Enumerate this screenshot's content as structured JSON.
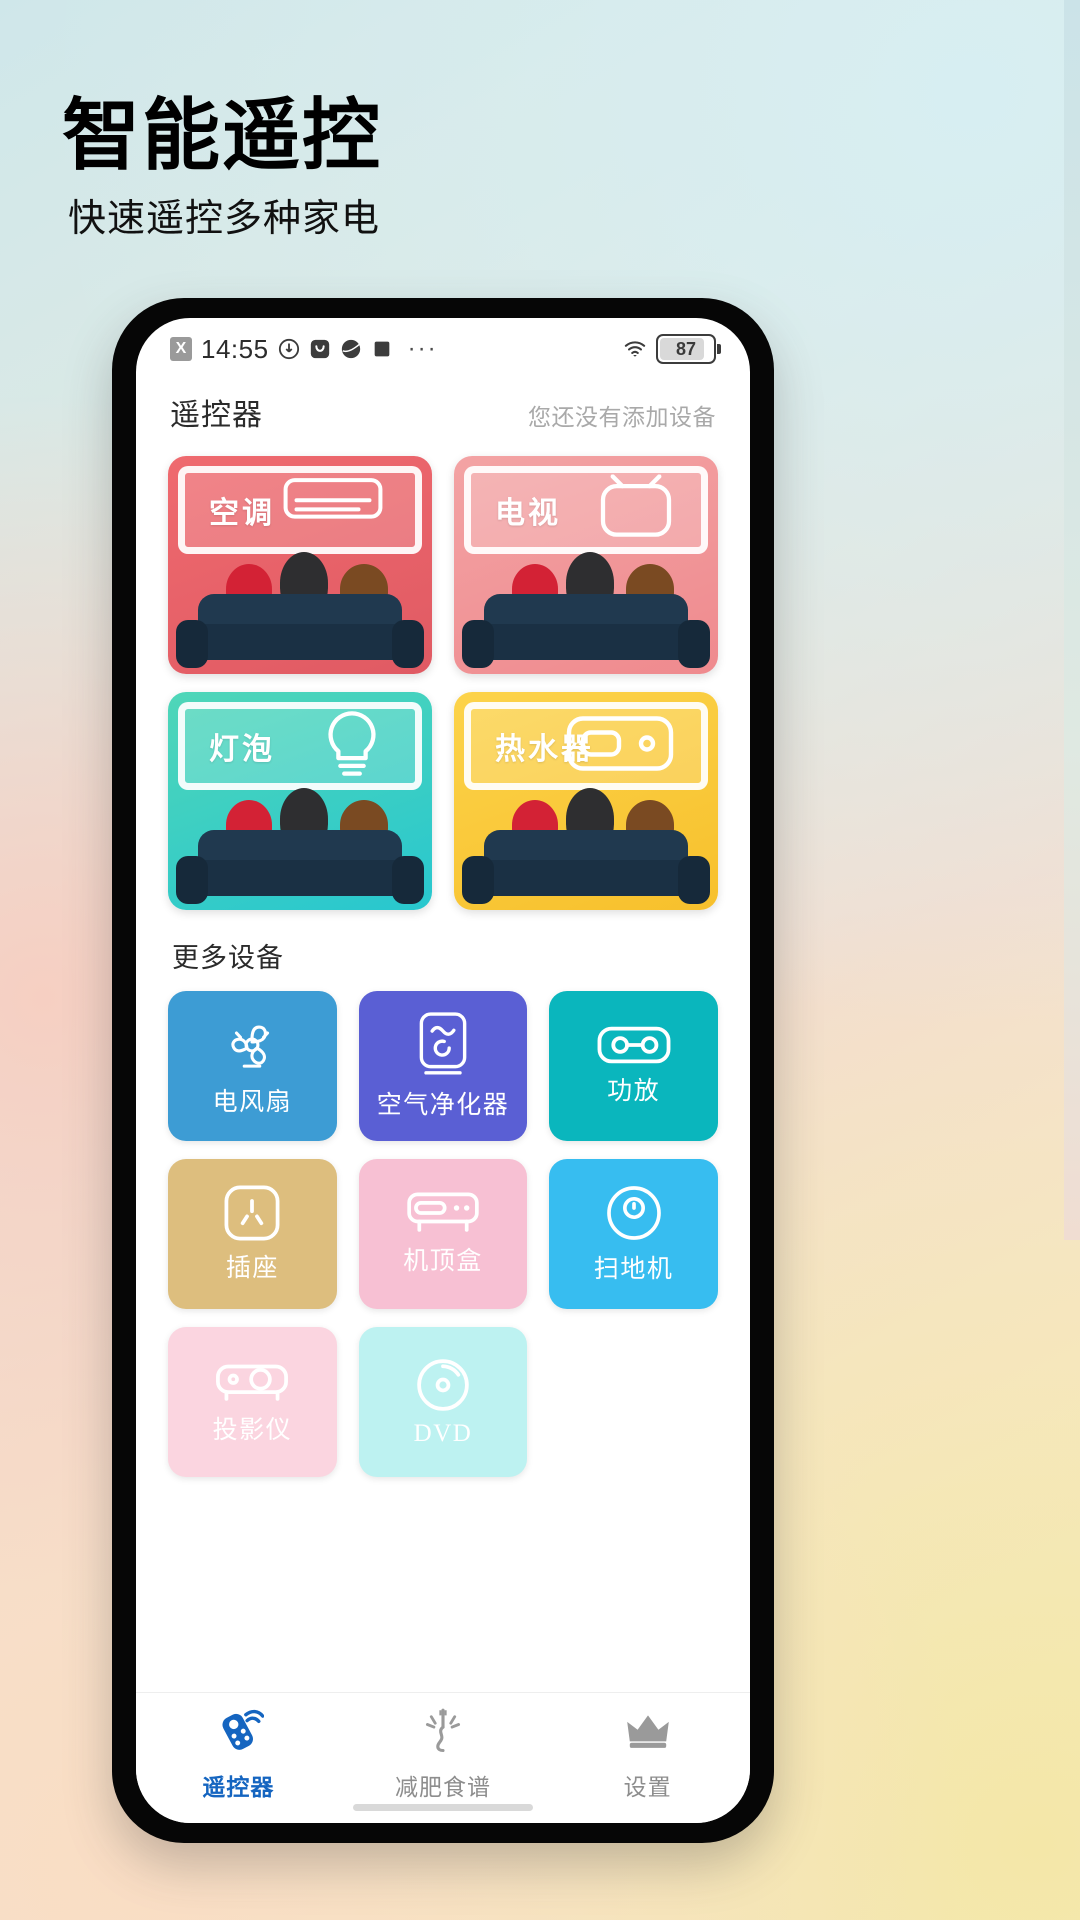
{
  "promo": {
    "title": "智能遥控",
    "subtitle": "快速遥控多种家电"
  },
  "statusbar": {
    "sim_badge": "X",
    "time": "14:55",
    "overflow_dots": "···",
    "battery_percent": "87",
    "icons": [
      "sim-x-icon",
      "clock-arrow-icon",
      "message-icon",
      "globe-icon",
      "square-icon",
      "more-dots-icon",
      "wifi-icon",
      "battery-icon"
    ]
  },
  "app_header": {
    "title": "遥控器",
    "hint": "您还没有添加设备"
  },
  "featured_devices": [
    {
      "label": "空调",
      "icon": "air-conditioner-icon",
      "color_top": "#ef6a6f",
      "color_bottom": "#e05a63",
      "screen_bg": "rgba(255,255,255,0.18)"
    },
    {
      "label": "电视",
      "icon": "television-icon",
      "color_top": "#f3a3a4",
      "color_bottom": "#ef8a8e",
      "screen_bg": "rgba(255,255,255,0.20)"
    },
    {
      "label": "灯泡",
      "icon": "light-bulb-icon",
      "color_top": "#4fd6b8",
      "color_bottom": "#28c7cf",
      "screen_bg": "rgba(255,255,255,0.18)"
    },
    {
      "label": "热水器",
      "icon": "water-heater-icon",
      "color_top": "#fcd34a",
      "color_bottom": "#f7c02c",
      "screen_bg": "rgba(255,255,255,0.18)"
    }
  ],
  "more_section": {
    "title": "更多设备",
    "devices": [
      {
        "label": "电风扇",
        "icon": "fan-icon",
        "color": "#3d9cd4"
      },
      {
        "label": "空气净化器",
        "icon": "air-purifier-icon",
        "color": "#5a5fd4"
      },
      {
        "label": "功放",
        "icon": "amplifier-icon",
        "color": "#0ab6bd"
      },
      {
        "label": "插座",
        "icon": "power-socket-icon",
        "color": "#ddbe7e"
      },
      {
        "label": "机顶盒",
        "icon": "set-top-box-icon",
        "color": "#f7c0d3"
      },
      {
        "label": "扫地机",
        "icon": "robot-vacuum-icon",
        "color": "#37bdf0"
      },
      {
        "label": "投影仪",
        "icon": "projector-icon",
        "color": "#fbd5e0"
      },
      {
        "label": "DVD",
        "icon": "dvd-icon",
        "color": "#bdf2f1"
      }
    ]
  },
  "tabbar": [
    {
      "label": "遥控器",
      "icon": "remote-control-icon",
      "active": true
    },
    {
      "label": "减肥食谱",
      "icon": "diet-recipe-icon",
      "active": false
    },
    {
      "label": "设置",
      "icon": "crown-settings-icon",
      "active": false
    }
  ]
}
